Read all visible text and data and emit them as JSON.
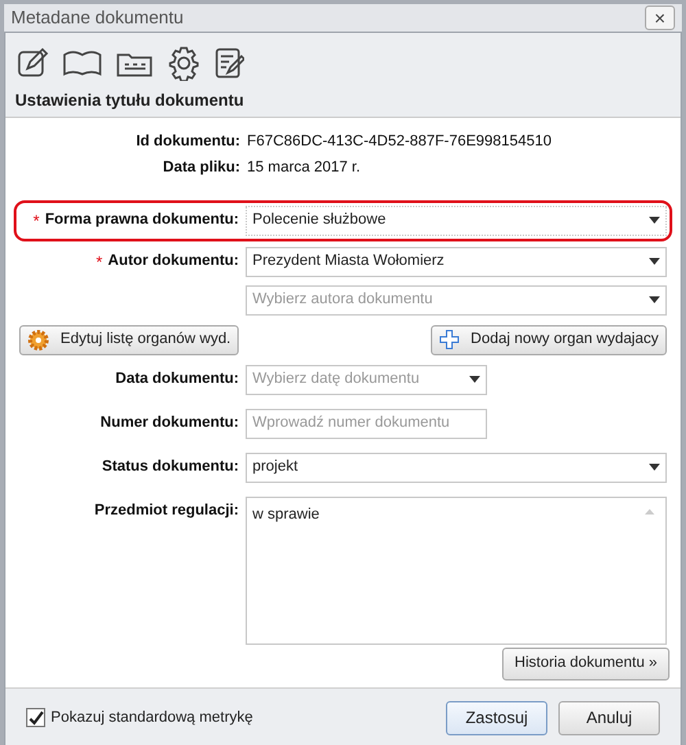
{
  "window": {
    "title": "Metadane dokumentu",
    "close": "×"
  },
  "toolbar": [
    {
      "kind": "edit"
    },
    {
      "kind": "book"
    },
    {
      "kind": "baw"
    },
    {
      "kind": "gear"
    },
    {
      "kind": "notes"
    }
  ],
  "section_title": "Ustawienia tytułu dokumentu",
  "info": [
    {
      "label": "Id dokumentu:",
      "value": "F67C86DC-413C-4D52-887F-76E998154510"
    },
    {
      "label": "Data pliku:",
      "value": "15 marca 2017 r."
    }
  ],
  "fields_top": [
    {
      "kind": "select",
      "label": "Forma prawna dokumentu:",
      "required_mark": "*",
      "highlighted": true,
      "value": "Polecenie służbowe",
      "wide": true
    },
    {
      "kind": "select",
      "label": "Autor dokumentu:",
      "required_mark": "*",
      "highlighted": false,
      "value": "Prezydent Miasta Wołomierz",
      "wide": true
    },
    {
      "kind": "select",
      "placeholder": "Wybierz autora dokumentu",
      "highlighted": false,
      "wide": true
    }
  ],
  "author_buttons": [
    {
      "kind": "gear",
      "label": "Edytuj listę organów wyd."
    },
    {
      "kind": "plus",
      "label": "Dodaj nowy organ wydajacy"
    }
  ],
  "fields_bottom": [
    {
      "kind": "select",
      "label": "Data dokumentu:",
      "highlighted": false,
      "placeholder": "Wybierz datę dokumentu",
      "wide": false
    },
    {
      "kind": "input",
      "label": "Numer dokumentu:",
      "highlighted": false,
      "placeholder": "Wprowadź numer dokumentu",
      "wide": false
    },
    {
      "kind": "select",
      "label": "Status dokumentu:",
      "highlighted": false,
      "value": "projekt",
      "wide": true
    },
    {
      "kind": "textarea",
      "label": "Przedmiot regulacji:",
      "highlighted": false,
      "value": "w sprawie",
      "wide": true
    }
  ],
  "history_button": "Historia dokumentu »",
  "footer": {
    "checkbox": {
      "label": "Pokazuj standardową metrykę",
      "checked": true
    },
    "buttons": [
      {
        "label": "Zastosuj",
        "primary": true
      },
      {
        "label": "Anuluj",
        "primary": false
      }
    ]
  }
}
